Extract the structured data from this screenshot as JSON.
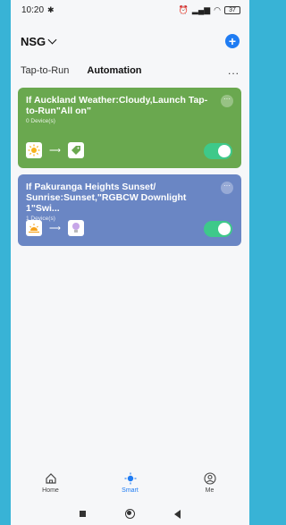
{
  "status_bar": {
    "time": "10:20",
    "battery": "37"
  },
  "header": {
    "home_name": "NSG",
    "add_label": "+"
  },
  "tabs": [
    {
      "label": "Tap-to-Run",
      "active": false
    },
    {
      "label": "Automation",
      "active": true
    }
  ],
  "more_label": "...",
  "cards": [
    {
      "title": "If Auckland Weather:Cloudy,Launch Tap-to-Run\"All on\"",
      "devices": "0 Device(s)",
      "color": "#6aa84f",
      "enabled": true
    },
    {
      "title": "If Pakuranga Heights Sunset/ Sunrise:Sunset,\"RGBCW Downlight 1\"Swi...",
      "devices": "1 Device(s)",
      "color": "#6a86c4",
      "enabled": true
    }
  ],
  "card_more_label": "···",
  "bottom_nav": [
    {
      "label": "Home",
      "icon": "home-icon"
    },
    {
      "label": "Smart",
      "icon": "smart-icon",
      "active": true
    },
    {
      "label": "Me",
      "icon": "profile-icon"
    }
  ],
  "colors": {
    "accent": "#1f7cf3",
    "toggle_on": "#3ec98a"
  }
}
